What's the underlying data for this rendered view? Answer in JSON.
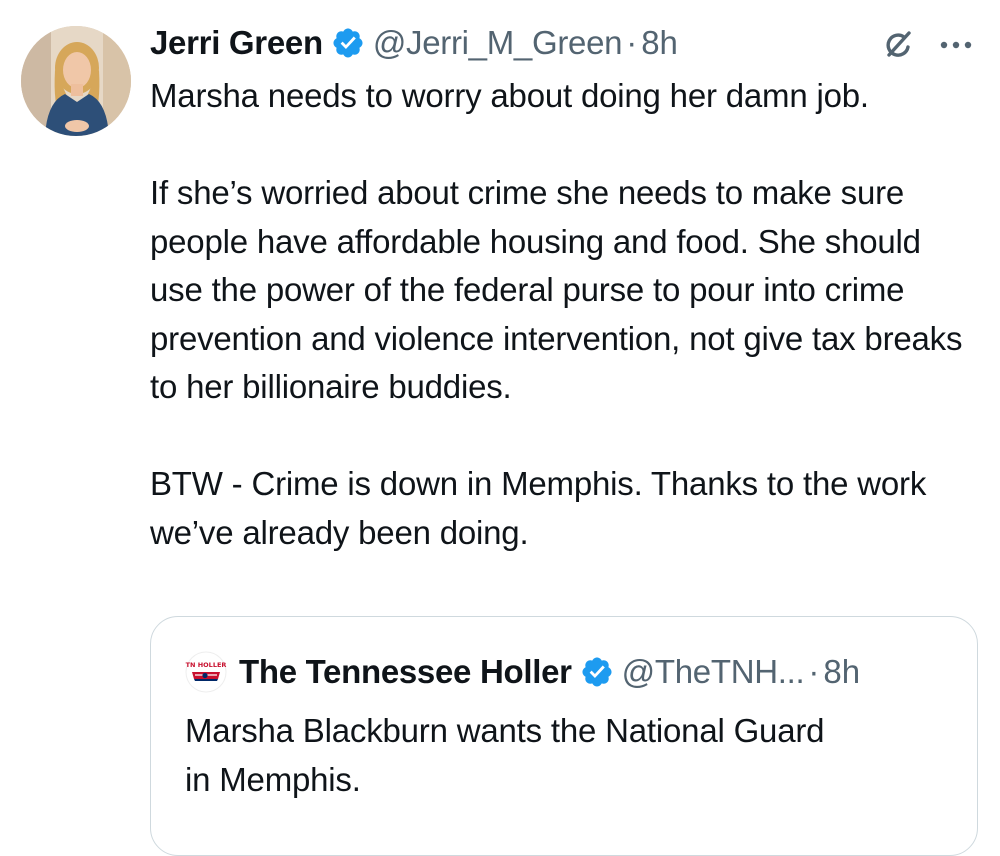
{
  "tweet": {
    "display_name": "Jerri Green",
    "handle": "@Jerri_M_Green",
    "separator": "·",
    "time": "8h",
    "text": "Marsha needs to worry about doing her damn job.\n\nIf she’s worried about crime she needs to make sure people have affordable housing and food. She should use the power of the federal purse to pour into crime prevention and violence intervention, not give tax breaks to her billionaire buddies.\n\nBTW - Crime is down in Memphis. Thanks to the work we’ve already been doing."
  },
  "quote": {
    "avatar_text": "TN HOLLER",
    "display_name": "The Tennessee Holler",
    "handle": "@TheTNH...",
    "separator": "·",
    "time": "8h",
    "text": "Marsha Blackburn wants the National Guard\nin Memphis."
  },
  "icons": {
    "verified": "verified-badge-icon",
    "grok": "grok-icon",
    "more": "more-options-icon"
  },
  "colors": {
    "verified_blue": "#1d9bf0",
    "text_primary": "#0f1419",
    "text_secondary": "#536471",
    "border": "#cfd9de"
  }
}
